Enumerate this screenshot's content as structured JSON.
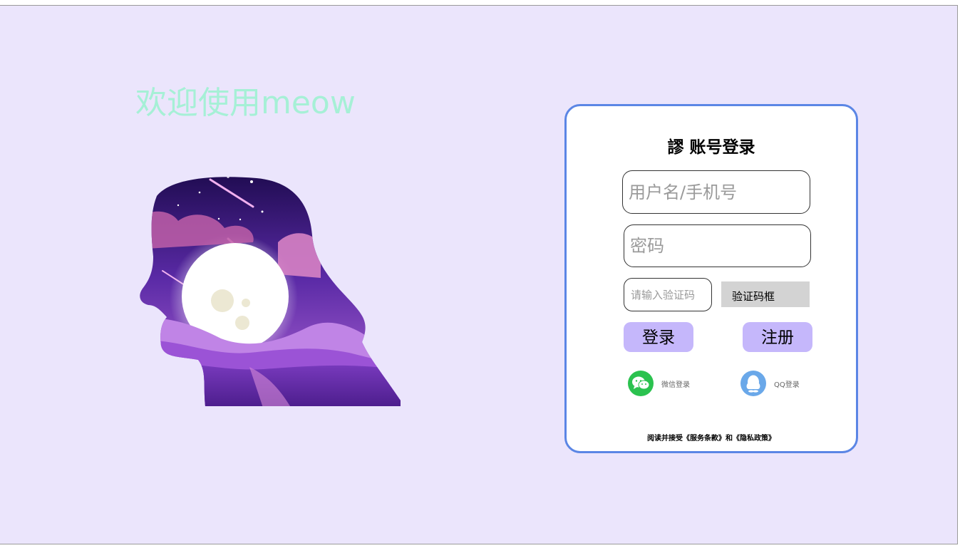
{
  "welcome": {
    "text": "欢迎使用meow"
  },
  "login": {
    "title": "謬 账号登录",
    "username_placeholder": "用户名/手机号",
    "password_placeholder": "密码",
    "code_placeholder": "请输入验证码",
    "captcha_label": "验证码框",
    "login_button": "登录",
    "register_button": "注册",
    "wechat_label": "微信登录",
    "qq_label": "QQ登录",
    "terms": "阅读并接受《服务条款》和《隐私政策》"
  },
  "colors": {
    "background": "#ebe5fc",
    "welcome_text": "#a6f0d6",
    "card_border": "#5b86e5",
    "button": "#c5b7fb",
    "wechat": "#2bc24f",
    "qq": "#6aa8e9"
  },
  "icons": {
    "wechat": "wechat-icon",
    "qq": "qq-penguin-icon",
    "illustration": "head-silhouette-moon-night-illustration"
  }
}
